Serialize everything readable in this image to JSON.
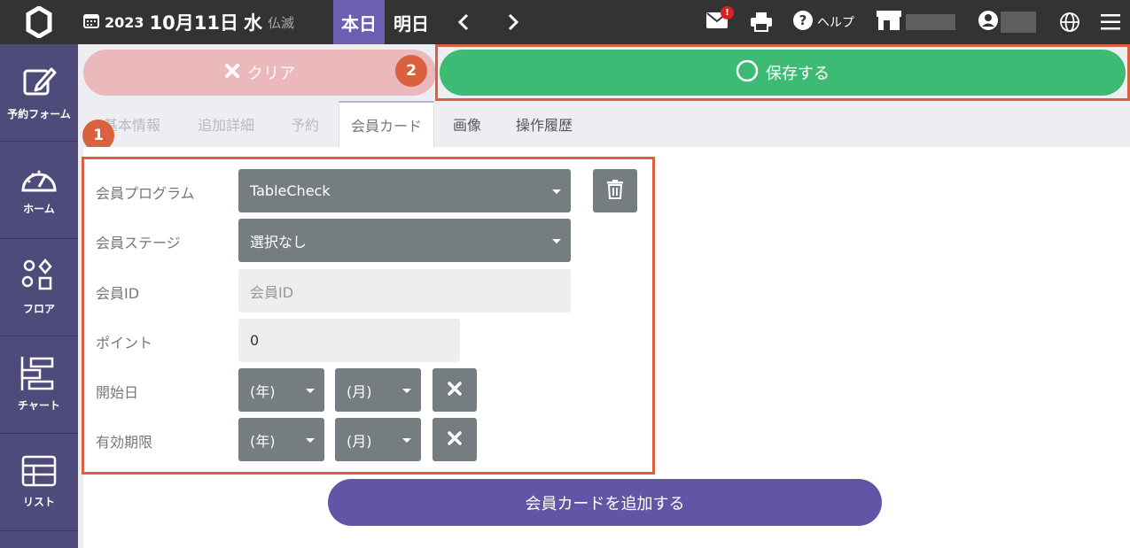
{
  "topbar": {
    "date": {
      "year": "2023",
      "month_day": "10月11日",
      "day_of_week": "水",
      "rokuyo": "仏滅"
    },
    "today_label": "本日",
    "tomorrow_label": "明日",
    "mail_badge": "!",
    "help_label": "ヘルプ",
    "icons": [
      "logo-icon",
      "calendar-icon",
      "chevron-left-icon",
      "chevron-right-icon",
      "mail-icon",
      "printer-icon",
      "help-icon",
      "store-icon",
      "user-icon",
      "globe-icon",
      "menu-icon"
    ]
  },
  "sidebar": {
    "items": [
      {
        "label": "予約フォーム",
        "icon": "edit-icon"
      },
      {
        "label": "ホーム",
        "icon": "dashboard-icon"
      },
      {
        "label": "フロア",
        "icon": "floor-shapes-icon"
      },
      {
        "label": "チャート",
        "icon": "chart-icon"
      },
      {
        "label": "リスト",
        "icon": "table-icon"
      }
    ]
  },
  "actions": {
    "clear_label": "クリア",
    "save_label": "保存する"
  },
  "markers": {
    "form": "1",
    "save": "2"
  },
  "tabs": [
    {
      "label": "基本情報",
      "state": "disabled"
    },
    {
      "label": "追加詳細",
      "state": "disabled"
    },
    {
      "label": "予約",
      "state": "disabled"
    },
    {
      "label": "会員カード",
      "state": "active"
    },
    {
      "label": "画像",
      "state": "normal"
    },
    {
      "label": "操作履歴",
      "state": "normal"
    }
  ],
  "member_form": {
    "program_label": "会員プログラム",
    "program_value": "TableCheck",
    "stage_label": "会員ステージ",
    "stage_value": "選択なし",
    "member_id_label": "会員ID",
    "member_id_placeholder": "会員ID",
    "points_label": "ポイント",
    "points_value": "0",
    "start_label": "開始日",
    "start_year": "(年)",
    "start_month": "(月)",
    "expiry_label": "有効期限",
    "expiry_year": "(年)",
    "expiry_month": "(月)"
  },
  "add_card_label": "会員カードを追加する",
  "colors": {
    "topbar": "#333333",
    "sidebar": "#4e4a7a",
    "today_active": "#6a5fb0",
    "clear_button": "#ebb8bc",
    "save_button": "#3dbb75",
    "annotation": "#d9613e",
    "select_bg": "#757d80",
    "add_button": "#6155a6"
  }
}
